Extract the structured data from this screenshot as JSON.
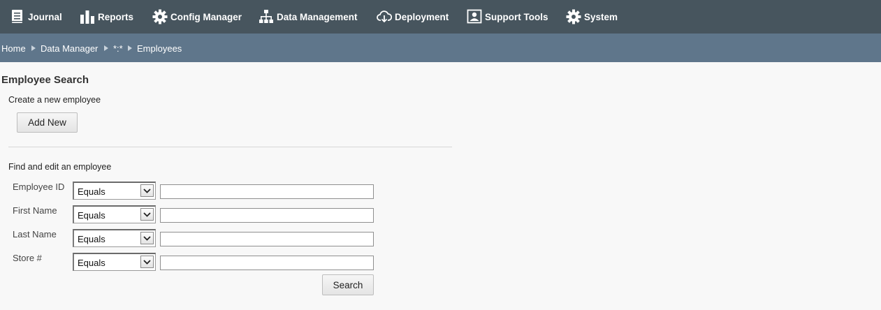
{
  "nav": {
    "items": [
      {
        "label": "Journal",
        "icon": "journal-icon"
      },
      {
        "label": "Reports",
        "icon": "bar-chart-icon"
      },
      {
        "label": "Config Manager",
        "icon": "gear-icon"
      },
      {
        "label": "Data Management",
        "icon": "sitemap-icon"
      },
      {
        "label": "Deployment",
        "icon": "cloud-download-icon"
      },
      {
        "label": "Support Tools",
        "icon": "user-badge-icon"
      },
      {
        "label": "System",
        "icon": "gear-icon"
      }
    ]
  },
  "breadcrumb": [
    "Home",
    "Data Manager",
    "*:*",
    "Employees"
  ],
  "page": {
    "title": "Employee Search",
    "create_text": "Create a new employee",
    "add_new_label": "Add New",
    "find_text": "Find and edit an employee",
    "search_label": "Search"
  },
  "search_fields": [
    {
      "label": "Employee ID",
      "operator": "Equals",
      "value": ""
    },
    {
      "label": "First Name",
      "operator": "Equals",
      "value": ""
    },
    {
      "label": "Last Name",
      "operator": "Equals",
      "value": ""
    },
    {
      "label": "Store #",
      "operator": "Equals",
      "value": ""
    }
  ],
  "colors": {
    "nav_bg": "#47555e",
    "breadcrumb_bg": "#5f768b",
    "page_bg": "#f8f8f8"
  }
}
